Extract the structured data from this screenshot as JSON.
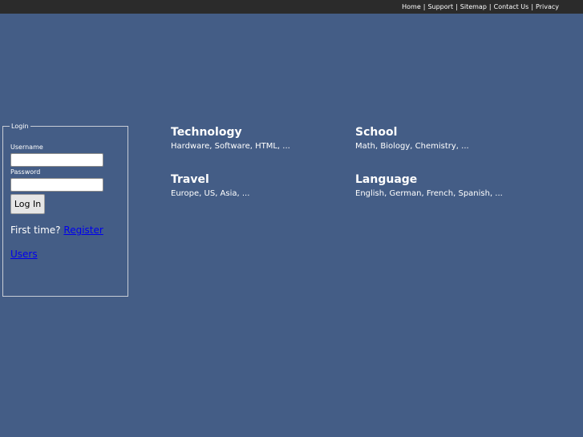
{
  "topnav": {
    "links": [
      "Home",
      "Support",
      "Sitemap",
      "Contact Us",
      "Privacy"
    ],
    "separator": "|"
  },
  "login": {
    "legend": "Login",
    "username_label": "Username",
    "username_value": "",
    "password_label": "Password",
    "password_value": "",
    "button_label": "Log In",
    "first_time_text": "First time?",
    "register_link": "Register",
    "users_link": "Users"
  },
  "categories": [
    {
      "title": "Technology",
      "desc": "Hardware, Software, HTML, ..."
    },
    {
      "title": "School",
      "desc": "Math, Biology, Chemistry, ..."
    },
    {
      "title": "Travel",
      "desc": "Europe, US, Asia, ..."
    },
    {
      "title": "Language",
      "desc": "English, German, French, Spanish, ..."
    }
  ],
  "colors": {
    "background": "#445d86",
    "topbar": "#2b2b2b",
    "link": "#0000ee"
  }
}
